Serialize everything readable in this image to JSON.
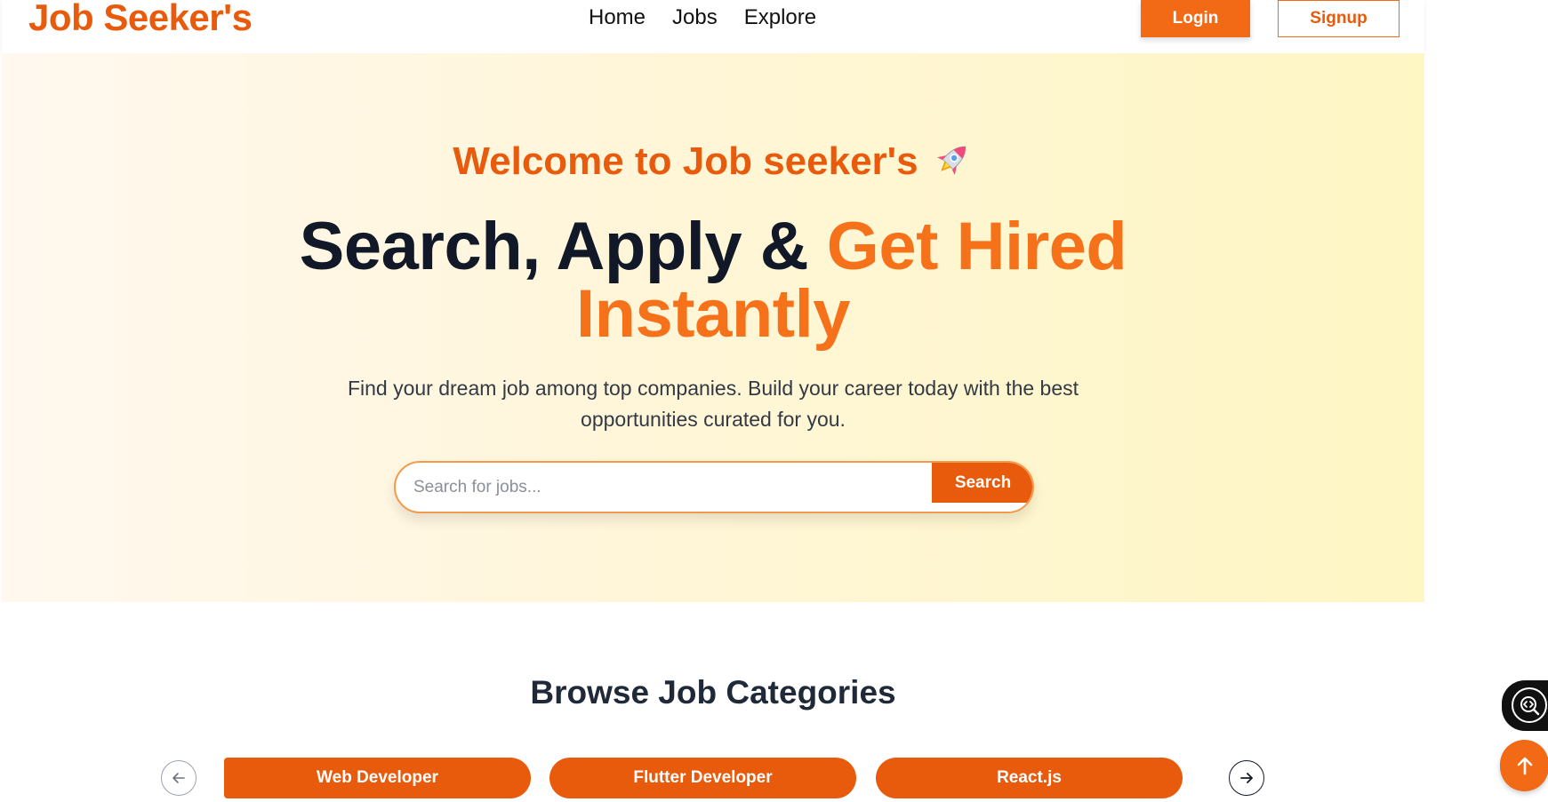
{
  "colors": {
    "brand": "#e85a0c",
    "accent": "#f5721b",
    "heading": "#111827",
    "hero_gradient_start": "#fff8ef",
    "hero_gradient_end": "#fef6c3"
  },
  "header": {
    "logo": "Job Seeker's",
    "nav": [
      {
        "label": "Home"
      },
      {
        "label": "Jobs"
      },
      {
        "label": "Explore"
      }
    ],
    "login_label": "Login",
    "signup_label": "Signup"
  },
  "hero": {
    "welcome": "Welcome to Job seeker's",
    "welcome_icon": "rocket-icon",
    "headline_part1": "Search, Apply & ",
    "headline_accent": "Get Hired",
    "headline_line2": "Instantly",
    "subtitle": "Find your dream job among top companies. Build your career today with the best opportunities curated for you.",
    "search": {
      "placeholder": "Search for jobs...",
      "value": "",
      "button_label": "Search"
    }
  },
  "categories": {
    "title": "Browse Job Categories",
    "items": [
      {
        "label": "Web Developer"
      },
      {
        "label": "Flutter Developer"
      },
      {
        "label": "React.js"
      }
    ],
    "prev_icon": "arrow-left-icon",
    "next_icon": "arrow-right-icon"
  },
  "floating": {
    "devtools_icon": "code-search-icon",
    "scroll_top_icon": "arrow-up-icon"
  }
}
